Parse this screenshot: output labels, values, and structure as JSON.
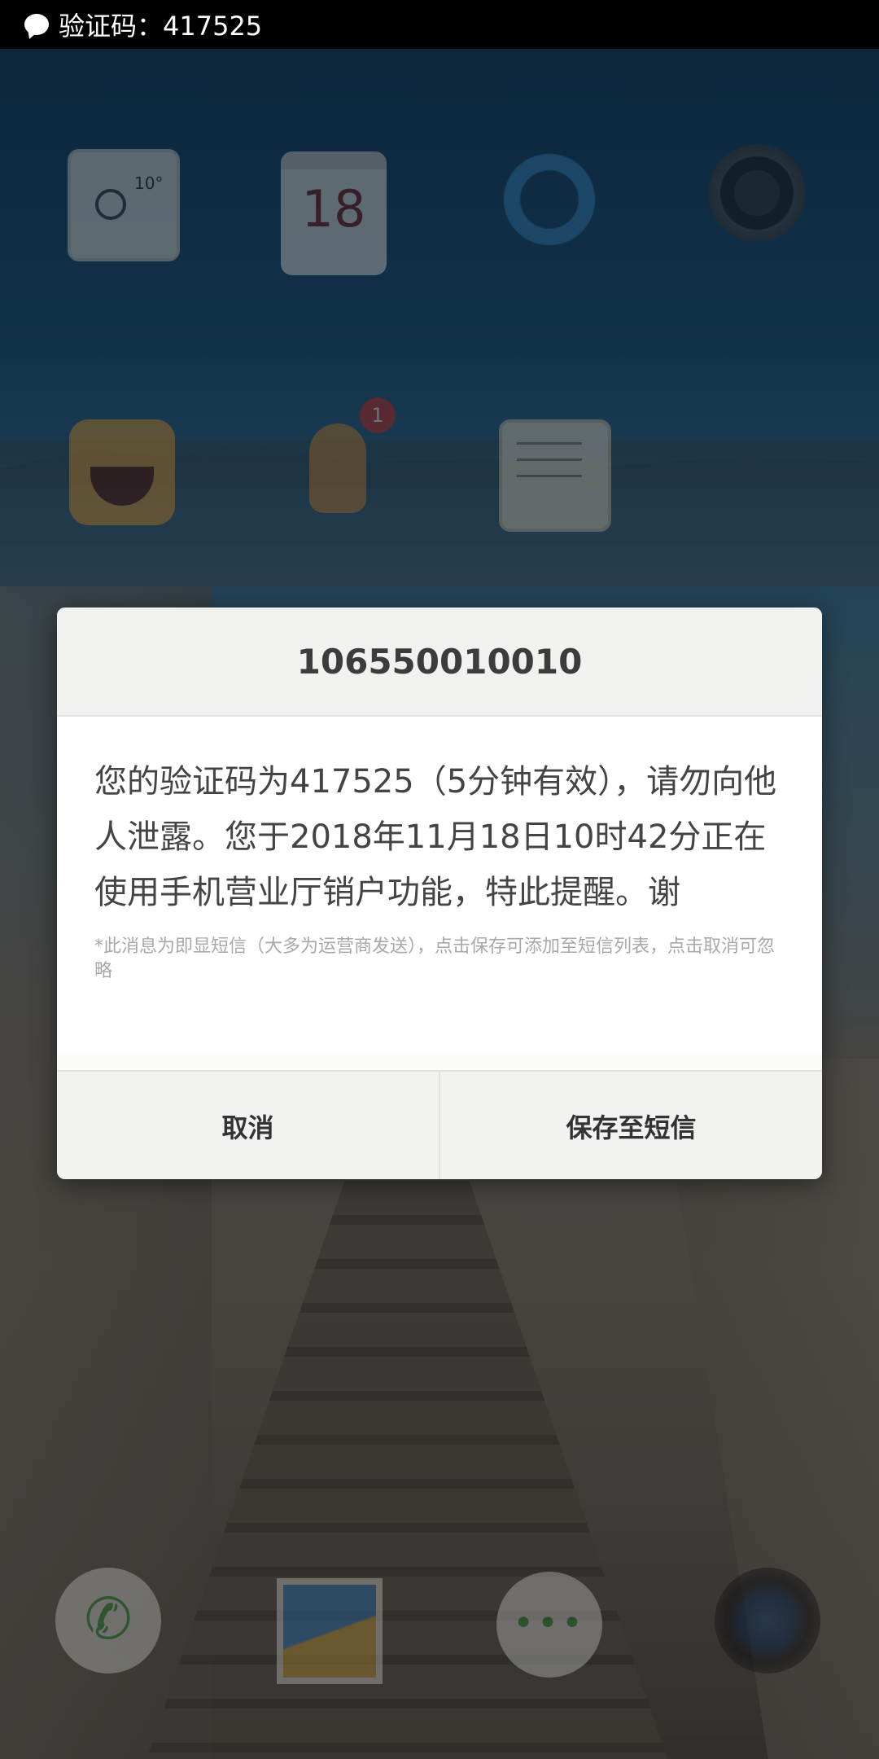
{
  "status_bar": {
    "notification_icon": "chat-bubble-icon",
    "text": "验证码：417525"
  },
  "home": {
    "weather_temp": "10°",
    "calendar_day": "18",
    "game_badge_count": "1",
    "dock_phone_icon": "phone-icon",
    "dock_messages_icon": "messages-icon"
  },
  "dialog": {
    "sender": "106550010010",
    "message": "您的验证码为417525（5分钟有效），请勿向他人泄露。您于2018年11月18日10时42分正在使用手机营业厅销户功能，特此提醒。谢",
    "note": "*此消息为即显短信（大多为运营商发送），点击保存可添加至短信列表，点击取消可忽略",
    "cancel_label": "取消",
    "save_label": "保存至短信"
  },
  "colors": {
    "status_bar_bg": "#000000",
    "dialog_bg": "#ffffff",
    "dialog_header_bg": "#f1f1f0",
    "text_primary": "#444444",
    "note_text": "#a8a8a8",
    "badge_red": "#d8302b"
  }
}
